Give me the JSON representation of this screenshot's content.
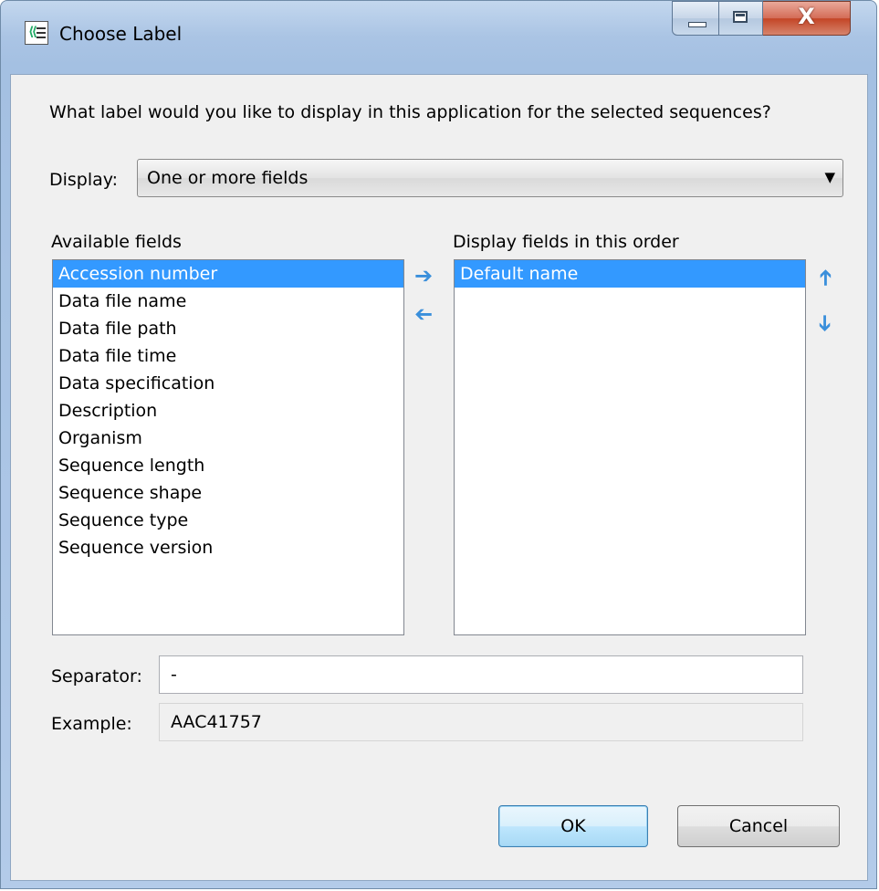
{
  "window": {
    "title": "Choose Label",
    "close_symbol": "X"
  },
  "icons": {
    "app": "label-chooser-icon",
    "dropdown": "chevron-down-icon",
    "add": "arrow-right-icon",
    "remove": "arrow-left-icon",
    "move_up": "arrow-up-icon",
    "move_down": "arrow-down-icon"
  },
  "prompt": "What label would you like to display in this application for the selected sequences?",
  "display": {
    "label": "Display:",
    "value": "One or more fields"
  },
  "available": {
    "heading": "Available fields",
    "items": [
      "Accession number",
      "Data file name",
      "Data file path",
      "Data file time",
      "Data specification",
      "Description",
      "Organism",
      "Sequence length",
      "Sequence shape",
      "Sequence type",
      "Sequence version"
    ],
    "selected_index": 0
  },
  "ordered": {
    "heading": "Display fields in this order",
    "items": [
      "Default name"
    ],
    "selected_index": 0
  },
  "separator": {
    "label": "Separator:",
    "value": "-"
  },
  "example": {
    "label": "Example:",
    "value": "AAC41757"
  },
  "buttons": {
    "ok": "OK",
    "cancel": "Cancel"
  },
  "colors": {
    "selection": "#3399ff",
    "arrow": "#3a8fdb"
  }
}
